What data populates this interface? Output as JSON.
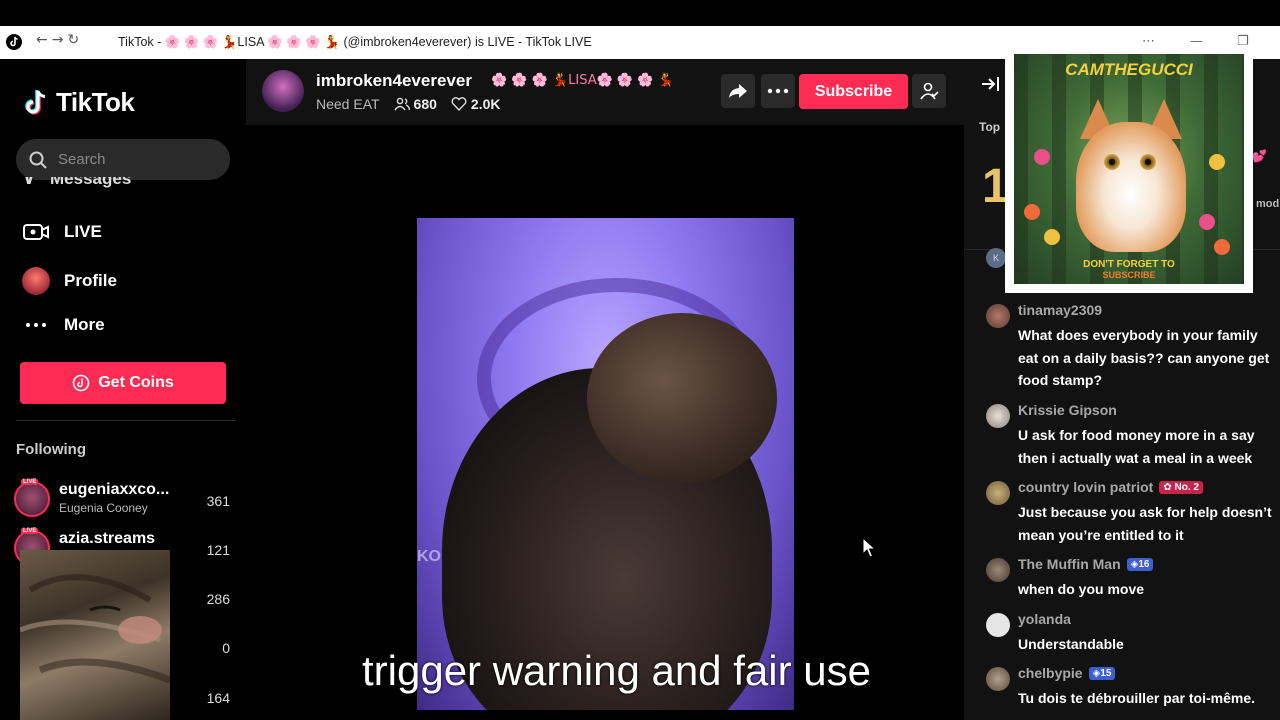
{
  "window": {
    "title": "TikTok - 🌸 🌸 🌸 💃LISA 🌸 🌸 🌸 💃 (@imbroken4everever) is LIVE - TikTok LIVE",
    "menu_glyph": "⋯",
    "minimize_glyph": "—",
    "restore_glyph": "❐"
  },
  "sidebar": {
    "logo_text": "TikTok",
    "search_placeholder": "Search",
    "clipped_item": "Messages",
    "nav": [
      {
        "label": "LIVE",
        "icon": "live-camera-icon"
      },
      {
        "label": "Profile",
        "icon": "profile-avatar-icon"
      },
      {
        "label": "More",
        "icon": "more-dots-icon"
      }
    ],
    "get_coins_label": "Get Coins",
    "following_label": "Following",
    "following": [
      {
        "name": "eugeniaxxco...",
        "sub": "Eugenia Cooney",
        "count": "361"
      },
      {
        "name": "azia.streams",
        "sub": "",
        "count": "121"
      }
    ],
    "extra_counts": [
      "286",
      "0",
      "164"
    ]
  },
  "stream": {
    "host_name": "imbroken4everever",
    "host_deco": "🌸 🌸 🌸 💃LISA🌸 🌸 🌸 💃",
    "topic": "Need EAT",
    "viewers": "680",
    "likes": "2.0K",
    "subscribe_label": "Subscribe",
    "video_watermark": "KO",
    "caption": "trigger warning and fair use"
  },
  "chat": {
    "top_label": "Top",
    "top_number": "1",
    "clip_right_top": "z💕",
    "clip_right_mod": "mod",
    "clip_avatar_letter": "K",
    "messages": [
      {
        "user": "tinamay2309",
        "badge": "",
        "text": "What does everybody in your family eat on a daily basis?? can anyone get food stamp?"
      },
      {
        "user": "Krissie Gipson",
        "badge": "",
        "text": "U ask for food money more in a say then i actually wat a meal in a week"
      },
      {
        "user": "country lovin patriot",
        "badge": "No. 2",
        "text": "Just because you ask for help doesn’t mean you’re entitled to it"
      },
      {
        "user": "The Muffin Man",
        "badge": "16",
        "text": "when do you move"
      },
      {
        "user": "yolanda",
        "badge": "",
        "text": "Understandable"
      },
      {
        "user": "chelbypie",
        "badge": "15",
        "text": "Tu dois te débrouiller par toi-même."
      }
    ]
  },
  "poster": {
    "brand": "CAMTHEGUCCI",
    "cta_line1": "DON'T FORGET TO",
    "cta_line2": "SUBSCRIBE"
  },
  "colors": {
    "accent": "#fe2c55",
    "panel": "#121212",
    "video_purple": "#8f78f0"
  }
}
